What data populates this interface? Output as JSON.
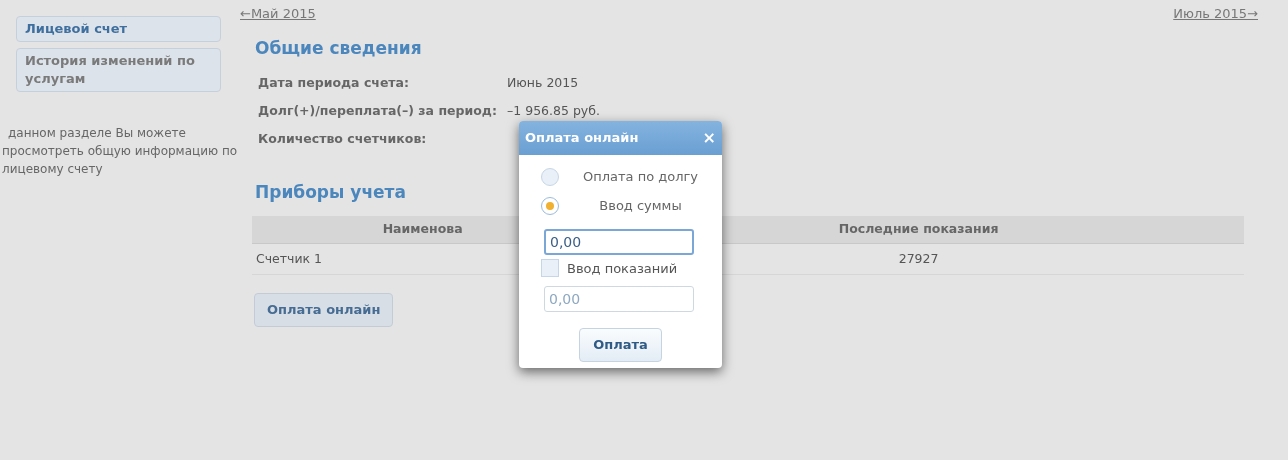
{
  "nav": {
    "prev": "←Май 2015",
    "next": "Июль 2015→"
  },
  "sidebar": {
    "items": [
      {
        "label": "Лицевой счет",
        "selected": true
      },
      {
        "label": "История изменений по услугам",
        "selected": false
      }
    ],
    "note": "данном разделе Вы можете\nпросмотреть общую информацию по\nлицевому счету"
  },
  "general": {
    "title": "Общие сведения",
    "rows": [
      {
        "label": "Дата периода счета:",
        "value": "Июнь 2015"
      },
      {
        "label": "Долг(+)/переплата(–) за период:",
        "value": "–1 956.85 руб."
      },
      {
        "label": "Количество счетчиков:"
      }
    ]
  },
  "meters": {
    "title": "Приборы учета",
    "columns": [
      "Наименова",
      "Последние показания"
    ],
    "rows": [
      [
        "Счетчик 1",
        "27927"
      ]
    ],
    "button": "Оплата онлайн"
  },
  "modal": {
    "title": "Оплата онлайн",
    "close": "×",
    "options": [
      {
        "label": "Оплата по долгу",
        "selected": false
      },
      {
        "label": "Ввод суммы",
        "selected": true
      }
    ],
    "amount": {
      "value": "0,00"
    },
    "readings": {
      "label": "Ввод показаний",
      "checked": false,
      "placeholder": "0,00"
    },
    "button": "Оплата"
  }
}
